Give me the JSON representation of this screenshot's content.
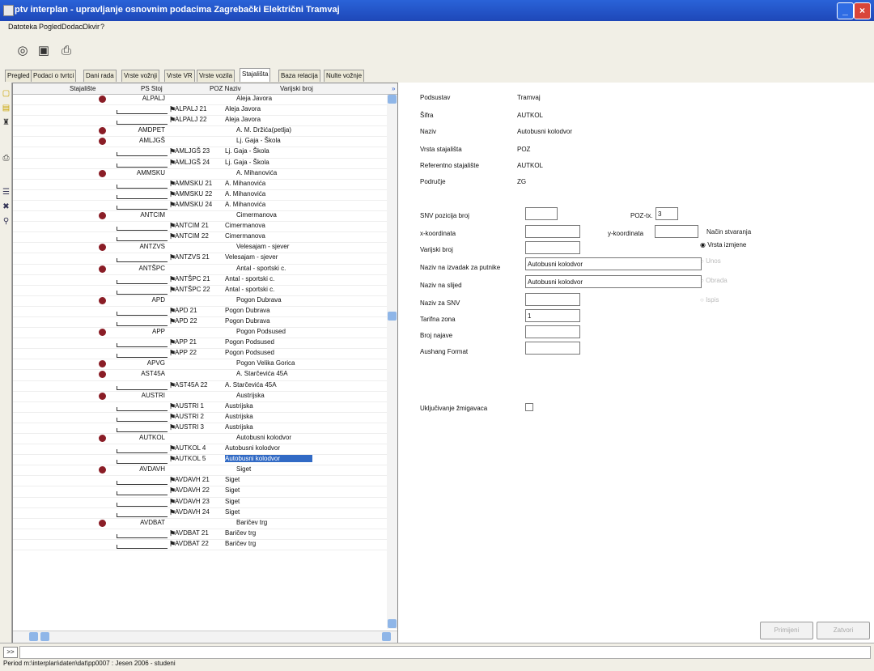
{
  "window": {
    "title": "ptv interplan - upravljanje osnovnim podacima Zagrebački Električni Tramvaj"
  },
  "menu": [
    "Datoteka",
    "Pogled",
    "Dodaci",
    "Okvir",
    "?"
  ],
  "toolbar": {
    "icons": [
      "binoculars-icon",
      "save-icon",
      "print-icon"
    ]
  },
  "tabs": [
    {
      "label": "Pregled",
      "active": false
    },
    {
      "label": "Podaci o tvrtci",
      "active": false
    },
    {
      "label": "Dani rada",
      "active": false
    },
    {
      "label": "Vrste vožnji",
      "active": false
    },
    {
      "label": "Vrste VR",
      "active": false
    },
    {
      "label": "Vrste vozila",
      "active": false
    },
    {
      "label": "Stajališta",
      "active": true
    },
    {
      "label": "Baza relacija",
      "active": false
    },
    {
      "label": "Nulte vožnje",
      "active": false
    }
  ],
  "tree": {
    "columns": [
      "Stajalište",
      "PS Stoj",
      "POZ Naziv",
      "Varijski broj"
    ],
    "rows": [
      {
        "kind": "parent",
        "code": "ALPALJ",
        "name": "Aleja Javora"
      },
      {
        "kind": "child",
        "code": "ALPALJ 21",
        "name": "Aleja Javora"
      },
      {
        "kind": "child",
        "code": "ALPALJ 22",
        "name": "Aleja Javora"
      },
      {
        "kind": "parent",
        "code": "AMDPET",
        "name": "A. M. Držića(petlja)"
      },
      {
        "kind": "parent",
        "code": "AMLJGŠ",
        "name": "Lj. Gaja - Škola"
      },
      {
        "kind": "child",
        "code": "AMLJGŠ 23",
        "name": "Lj. Gaja - Škola"
      },
      {
        "kind": "child",
        "code": "AMLJGŠ 24",
        "name": "Lj. Gaja - Škola"
      },
      {
        "kind": "parent",
        "code": "AMMSKU",
        "name": "A. Mihanovića"
      },
      {
        "kind": "child",
        "code": "AMMSKU 21",
        "name": "A. Mihanovića"
      },
      {
        "kind": "child",
        "code": "AMMSKU 22",
        "name": "A. Mihanovića"
      },
      {
        "kind": "child",
        "code": "AMMSKU 24",
        "name": "A. Mihanovića"
      },
      {
        "kind": "parent",
        "code": "ANTCIM",
        "name": "Cimermanova"
      },
      {
        "kind": "child",
        "code": "ANTCIM 21",
        "name": "Cimermanova"
      },
      {
        "kind": "child",
        "code": "ANTCIM 22",
        "name": "Cimermanova"
      },
      {
        "kind": "parent",
        "code": "ANTZVS",
        "name": "Velesajam - sjever"
      },
      {
        "kind": "child",
        "code": "ANTZVS 21",
        "name": "Velesajam - sjever"
      },
      {
        "kind": "parent",
        "code": "ANTŠPC",
        "name": "Antal - sportski c."
      },
      {
        "kind": "child",
        "code": "ANTŠPC 21",
        "name": "Antal - sportski c."
      },
      {
        "kind": "child",
        "code": "ANTŠPC 22",
        "name": "Antal - sportski c."
      },
      {
        "kind": "parent",
        "code": "APD",
        "name": "Pogon Dubrava"
      },
      {
        "kind": "child",
        "code": "APD 21",
        "name": "Pogon Dubrava"
      },
      {
        "kind": "child",
        "code": "APD 22",
        "name": "Pogon Dubrava"
      },
      {
        "kind": "parent",
        "code": "APP",
        "name": "Pogon Podsused"
      },
      {
        "kind": "child",
        "code": "APP 21",
        "name": "Pogon Podsused"
      },
      {
        "kind": "child",
        "code": "APP 22",
        "name": "Pogon Podsused"
      },
      {
        "kind": "parent",
        "code": "APVG",
        "name": "Pogon Velika Gorica"
      },
      {
        "kind": "parent",
        "code": "AST45A",
        "name": "A. Starčevića 45A"
      },
      {
        "kind": "child",
        "code": "AST45A 22",
        "name": "A. Starčevića 45A"
      },
      {
        "kind": "parent",
        "code": "AUSTRI",
        "name": "Austrijska"
      },
      {
        "kind": "child",
        "code": "AUSTRI 1",
        "name": "Austrijska"
      },
      {
        "kind": "child",
        "code": "AUSTRI 2",
        "name": "Austrijska"
      },
      {
        "kind": "child",
        "code": "AUSTRI 3",
        "name": "Austrijska"
      },
      {
        "kind": "parent",
        "code": "AUTKOL",
        "name": "Autobusni kolodvor"
      },
      {
        "kind": "child",
        "code": "AUTKOL 4",
        "name": "Autobusni kolodvor"
      },
      {
        "kind": "child",
        "code": "AUTKOL 5",
        "name": "Autobusni kolodvor",
        "selected": true
      },
      {
        "kind": "parent",
        "code": "AVDAVH",
        "name": "Siget"
      },
      {
        "kind": "child",
        "code": "AVDAVH 21",
        "name": "Siget"
      },
      {
        "kind": "child",
        "code": "AVDAVH 22",
        "name": "Siget"
      },
      {
        "kind": "child",
        "code": "AVDAVH 23",
        "name": "Siget"
      },
      {
        "kind": "child",
        "code": "AVDAVH 24",
        "name": "Siget"
      },
      {
        "kind": "parent",
        "code": "AVDBAT",
        "name": "Baričev trg"
      },
      {
        "kind": "child",
        "code": "AVDBAT 21",
        "name": "Baričev trg"
      },
      {
        "kind": "child",
        "code": "AVDBAT 22",
        "name": "Baričev trg"
      }
    ]
  },
  "details": {
    "podsustav_label": "Podsustav",
    "podsustav_value": "Tramvaj",
    "sifra_label": "Šifra",
    "sifra_value": "AUTKOL",
    "naziv_label": "Naziv",
    "naziv_value": "Autobusni kolodvor",
    "vrsta_label": "Vrsta stajališta",
    "vrsta_value": "POZ",
    "ref_label": "Referentno stajalište",
    "ref_value": "AUTKOL",
    "podrucje_label": "Područje",
    "podrucje_value": "ZG"
  },
  "form": {
    "snv_label": "SNV pozicija broj",
    "snv_value": "",
    "poztx_label": "POZ-tx.",
    "poztx_value": "3",
    "xkoord_label": "x-koordinata",
    "xkoord_value": "",
    "ykoord_label": "y-koordinata",
    "ykoord_value": "",
    "varijski_label": "Varijski broj",
    "varijski_value": "",
    "izvadak_label": "Naziv na izvadak za putnike",
    "izvadak_value": "Autobusni kolodvor",
    "sljed_label": "Naziv na slijed",
    "sljed_value": "Autobusni kolodvor",
    "nazivsnv_label": "Naziv za SNV",
    "nazivsnv_value": "",
    "tarifna_label": "Tarifna zona",
    "tarifna_value": "1",
    "najava_label": "Broj najave",
    "najava_value": "",
    "aushang_label": "Aushang Format",
    "aushang_value": "",
    "ukljucivanje_label": "Uključivanje žmigavaca",
    "nacin_label": "Način stvaranja",
    "radio_options": [
      {
        "label": "Vrsta izmjene",
        "on": true
      },
      {
        "label": "Unos",
        "on": false
      },
      {
        "label": "Obrada",
        "on": false
      },
      {
        "label": "Ispis",
        "on": false
      }
    ],
    "btn_primjeni": "Primijeni",
    "btn_zatvori": "Zatvori"
  },
  "status": {
    "cmd_button": ">>",
    "path": "Period m:\\interplan\\daten\\dat\\pp0007 : Jesen 2006 - studeni"
  }
}
